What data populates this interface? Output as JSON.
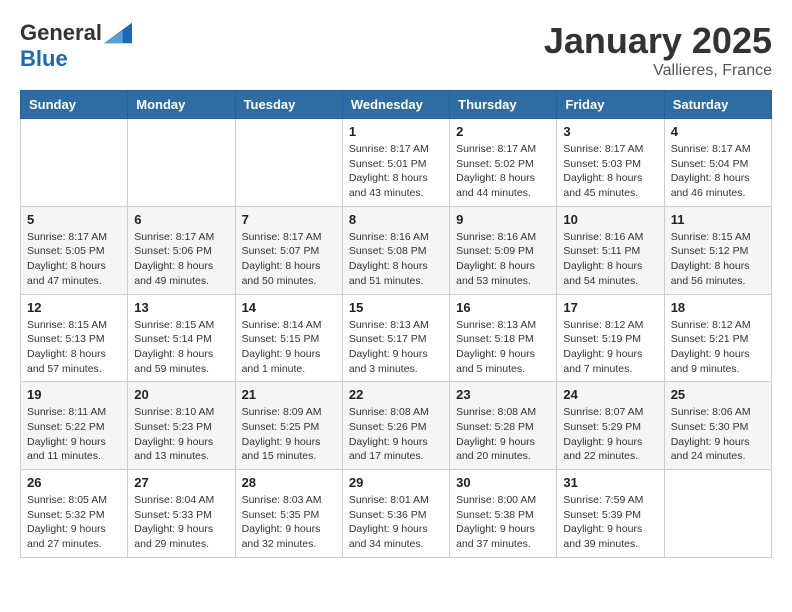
{
  "header": {
    "logo": {
      "general": "General",
      "blue": "Blue"
    },
    "title": "January 2025",
    "subtitle": "Vallieres, France"
  },
  "calendar": {
    "weekdays": [
      "Sunday",
      "Monday",
      "Tuesday",
      "Wednesday",
      "Thursday",
      "Friday",
      "Saturday"
    ],
    "weeks": [
      [
        {
          "day": "",
          "info": ""
        },
        {
          "day": "",
          "info": ""
        },
        {
          "day": "",
          "info": ""
        },
        {
          "day": "1",
          "info": "Sunrise: 8:17 AM\nSunset: 5:01 PM\nDaylight: 8 hours\nand 43 minutes."
        },
        {
          "day": "2",
          "info": "Sunrise: 8:17 AM\nSunset: 5:02 PM\nDaylight: 8 hours\nand 44 minutes."
        },
        {
          "day": "3",
          "info": "Sunrise: 8:17 AM\nSunset: 5:03 PM\nDaylight: 8 hours\nand 45 minutes."
        },
        {
          "day": "4",
          "info": "Sunrise: 8:17 AM\nSunset: 5:04 PM\nDaylight: 8 hours\nand 46 minutes."
        }
      ],
      [
        {
          "day": "5",
          "info": "Sunrise: 8:17 AM\nSunset: 5:05 PM\nDaylight: 8 hours\nand 47 minutes."
        },
        {
          "day": "6",
          "info": "Sunrise: 8:17 AM\nSunset: 5:06 PM\nDaylight: 8 hours\nand 49 minutes."
        },
        {
          "day": "7",
          "info": "Sunrise: 8:17 AM\nSunset: 5:07 PM\nDaylight: 8 hours\nand 50 minutes."
        },
        {
          "day": "8",
          "info": "Sunrise: 8:16 AM\nSunset: 5:08 PM\nDaylight: 8 hours\nand 51 minutes."
        },
        {
          "day": "9",
          "info": "Sunrise: 8:16 AM\nSunset: 5:09 PM\nDaylight: 8 hours\nand 53 minutes."
        },
        {
          "day": "10",
          "info": "Sunrise: 8:16 AM\nSunset: 5:11 PM\nDaylight: 8 hours\nand 54 minutes."
        },
        {
          "day": "11",
          "info": "Sunrise: 8:15 AM\nSunset: 5:12 PM\nDaylight: 8 hours\nand 56 minutes."
        }
      ],
      [
        {
          "day": "12",
          "info": "Sunrise: 8:15 AM\nSunset: 5:13 PM\nDaylight: 8 hours\nand 57 minutes."
        },
        {
          "day": "13",
          "info": "Sunrise: 8:15 AM\nSunset: 5:14 PM\nDaylight: 8 hours\nand 59 minutes."
        },
        {
          "day": "14",
          "info": "Sunrise: 8:14 AM\nSunset: 5:15 PM\nDaylight: 9 hours\nand 1 minute."
        },
        {
          "day": "15",
          "info": "Sunrise: 8:13 AM\nSunset: 5:17 PM\nDaylight: 9 hours\nand 3 minutes."
        },
        {
          "day": "16",
          "info": "Sunrise: 8:13 AM\nSunset: 5:18 PM\nDaylight: 9 hours\nand 5 minutes."
        },
        {
          "day": "17",
          "info": "Sunrise: 8:12 AM\nSunset: 5:19 PM\nDaylight: 9 hours\nand 7 minutes."
        },
        {
          "day": "18",
          "info": "Sunrise: 8:12 AM\nSunset: 5:21 PM\nDaylight: 9 hours\nand 9 minutes."
        }
      ],
      [
        {
          "day": "19",
          "info": "Sunrise: 8:11 AM\nSunset: 5:22 PM\nDaylight: 9 hours\nand 11 minutes."
        },
        {
          "day": "20",
          "info": "Sunrise: 8:10 AM\nSunset: 5:23 PM\nDaylight: 9 hours\nand 13 minutes."
        },
        {
          "day": "21",
          "info": "Sunrise: 8:09 AM\nSunset: 5:25 PM\nDaylight: 9 hours\nand 15 minutes."
        },
        {
          "day": "22",
          "info": "Sunrise: 8:08 AM\nSunset: 5:26 PM\nDaylight: 9 hours\nand 17 minutes."
        },
        {
          "day": "23",
          "info": "Sunrise: 8:08 AM\nSunset: 5:28 PM\nDaylight: 9 hours\nand 20 minutes."
        },
        {
          "day": "24",
          "info": "Sunrise: 8:07 AM\nSunset: 5:29 PM\nDaylight: 9 hours\nand 22 minutes."
        },
        {
          "day": "25",
          "info": "Sunrise: 8:06 AM\nSunset: 5:30 PM\nDaylight: 9 hours\nand 24 minutes."
        }
      ],
      [
        {
          "day": "26",
          "info": "Sunrise: 8:05 AM\nSunset: 5:32 PM\nDaylight: 9 hours\nand 27 minutes."
        },
        {
          "day": "27",
          "info": "Sunrise: 8:04 AM\nSunset: 5:33 PM\nDaylight: 9 hours\nand 29 minutes."
        },
        {
          "day": "28",
          "info": "Sunrise: 8:03 AM\nSunset: 5:35 PM\nDaylight: 9 hours\nand 32 minutes."
        },
        {
          "day": "29",
          "info": "Sunrise: 8:01 AM\nSunset: 5:36 PM\nDaylight: 9 hours\nand 34 minutes."
        },
        {
          "day": "30",
          "info": "Sunrise: 8:00 AM\nSunset: 5:38 PM\nDaylight: 9 hours\nand 37 minutes."
        },
        {
          "day": "31",
          "info": "Sunrise: 7:59 AM\nSunset: 5:39 PM\nDaylight: 9 hours\nand 39 minutes."
        },
        {
          "day": "",
          "info": ""
        }
      ]
    ]
  }
}
